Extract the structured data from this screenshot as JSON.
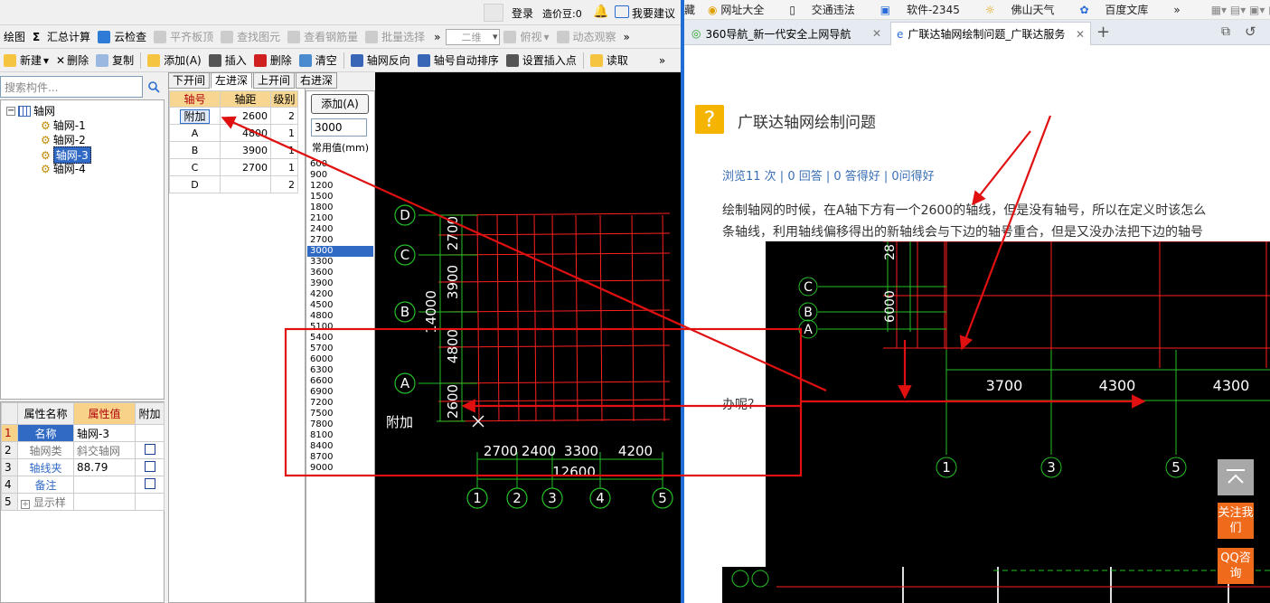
{
  "topbar": {
    "login": "登录",
    "cost_bean": "造价豆:0",
    "suggest": "我要建议"
  },
  "toolbar1": {
    "items": [
      "绘图",
      "汇总计算",
      "云检查",
      "平齐板顶",
      "查找图元",
      "查看钢筋量",
      "批量选择"
    ],
    "view_2d": "二维",
    "view_top": "俯视",
    "view_dyn": "动态观察",
    "more": "»"
  },
  "toolbar2": {
    "items": [
      "新建",
      "删除",
      "复制"
    ],
    "axis_items": [
      "添加(A)",
      "插入",
      "删除",
      "清空"
    ],
    "axis_tools": [
      "轴网反向",
      "轴号自动排序",
      "设置插入点"
    ],
    "read": "读取",
    "more": "»"
  },
  "search": {
    "placeholder": "搜索构件..."
  },
  "tree": {
    "root": "轴网",
    "children": [
      "轴网-1",
      "轴网-2",
      "轴网-3",
      "轴网-4"
    ]
  },
  "props": {
    "headers": [
      "属性名称",
      "属性值",
      "附加"
    ],
    "rows": [
      {
        "n": "1",
        "name": "名称",
        "value": "轴网-3"
      },
      {
        "n": "2",
        "name": "轴网类",
        "value": "斜交轴网"
      },
      {
        "n": "3",
        "name": "轴线夹",
        "value": "88.79"
      },
      {
        "n": "4",
        "name": "备注",
        "value": ""
      },
      {
        "n": "5",
        "name": "显示样",
        "value": ""
      }
    ]
  },
  "axis_tabs": [
    "下开间",
    "左进深",
    "上开间",
    "右进深"
  ],
  "axis_table": {
    "headers": [
      "轴号",
      "轴距",
      "级别"
    ],
    "rows": [
      {
        "axis": "附加",
        "dist": "2600",
        "level": "2"
      },
      {
        "axis": "A",
        "dist": "4800",
        "level": "1"
      },
      {
        "axis": "B",
        "dist": "3900",
        "level": "1"
      },
      {
        "axis": "C",
        "dist": "2700",
        "level": "1"
      },
      {
        "axis": "D",
        "dist": "",
        "level": "2"
      }
    ]
  },
  "add_button": "添加(A)",
  "value_input": "3000",
  "common_label": "常用值(mm)",
  "common_values": [
    "600",
    "900",
    "1200",
    "1500",
    "1800",
    "2100",
    "2400",
    "2700",
    "3000",
    "3300",
    "3600",
    "3900",
    "4200",
    "4500",
    "4800",
    "5100",
    "5400",
    "5700",
    "6000",
    "6300",
    "6600",
    "6900",
    "7200",
    "7500",
    "7800",
    "8100",
    "8400",
    "8700",
    "9000"
  ],
  "common_selected": "3000",
  "cad_left": {
    "row_labels": [
      "D",
      "C",
      "B",
      "A",
      "附加"
    ],
    "col_labels": [
      "1",
      "2",
      "3",
      "4",
      "5"
    ],
    "left_dims": [
      "2700",
      "3900",
      "4800",
      "2600"
    ],
    "left_total": "14000",
    "bottom_dims": [
      "2700",
      "2400",
      "3300",
      "4200"
    ],
    "bottom_total": "12600"
  },
  "favorites": [
    "藏",
    "网址大全",
    "交通违法",
    "软件-2345",
    "佛山天气",
    "百度文库",
    "»"
  ],
  "browser_tabs": [
    {
      "title": "360导航_新一代安全上网导航",
      "active": false
    },
    {
      "title": "广联达轴网绘制问题_广联达服务",
      "active": true
    }
  ],
  "new_tab": "+",
  "question": {
    "title": "广联达轴网绘制问题",
    "stats": "浏览11 次 | 0 回答 | 0 答得好 | 0问得好",
    "line1": "绘制轴网的时候，在A轴下方有一个2600的轴线，但是没有轴号，所以在定义时该怎么",
    "line2": "条轴线，利用轴线偏移得出的新轴线会与下边的轴号重合，但是又没办法把下边的轴号",
    "line3": "办呢？"
  },
  "cad_right": {
    "row_labels": [
      "C",
      "B",
      "A"
    ],
    "col_labels": [
      "1",
      "3",
      "5"
    ],
    "dims": [
      "3700",
      "4300",
      "4300"
    ],
    "left_dims": [
      "28",
      "6000"
    ]
  },
  "side_buttons": {
    "follow": "关注我们",
    "qq": "QQ咨询"
  },
  "colors": {
    "cad_bg": "#000000",
    "grid_red": "#ff2020",
    "grid_green": "#25c025",
    "annot_red": "#e01010",
    "selection_blue": "#316ac5",
    "accent_orange": "#f06a1b"
  }
}
